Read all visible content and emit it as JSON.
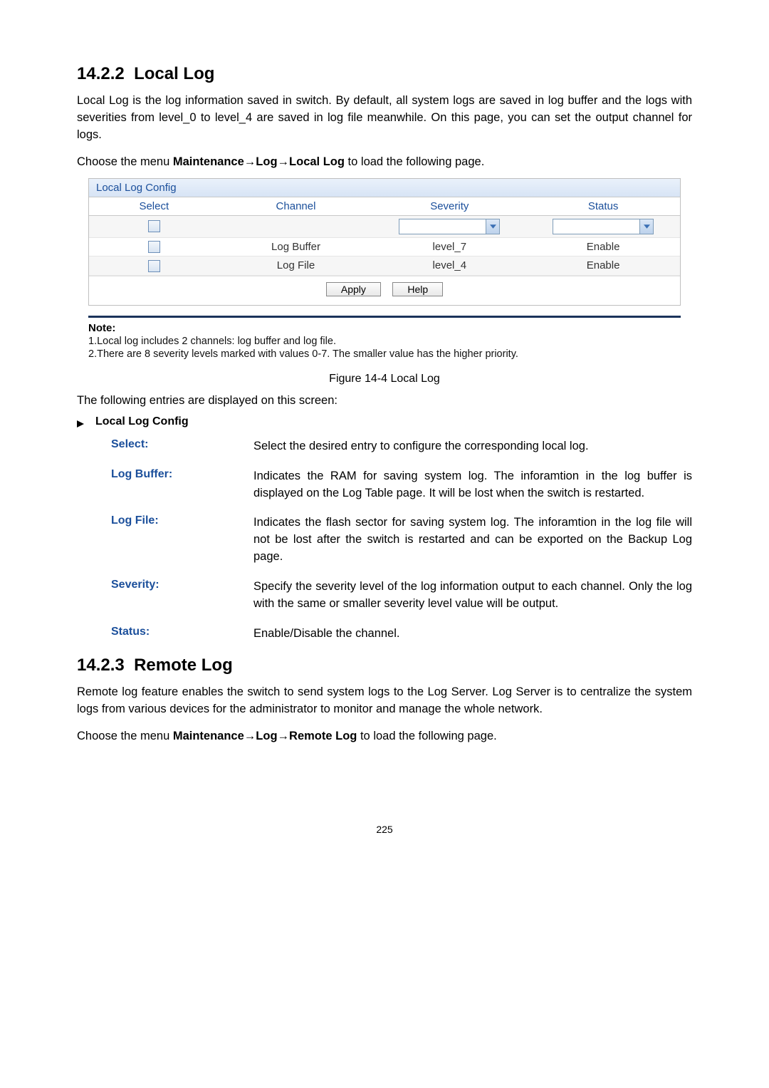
{
  "section1": {
    "number": "14.2.2",
    "title": "Local Log",
    "intro": "Local Log is the log information saved in switch. By default, all system logs are saved in log buffer and the logs with severities from level_0 to level_4 are saved in log file meanwhile. On this page, you can set the output channel for logs.",
    "menu_prefix": "Choose the menu ",
    "menu_path_1": "Maintenance",
    "menu_path_2": "Log",
    "menu_path_3": "Local Log",
    "menu_suffix": " to load the following page."
  },
  "panel": {
    "title": "Local Log Config",
    "headers": {
      "select": "Select",
      "channel": "Channel",
      "severity": "Severity",
      "status": "Status"
    },
    "row_config": {
      "channel": "",
      "severity": "",
      "status": ""
    },
    "row1": {
      "channel": "Log Buffer",
      "severity": "level_7",
      "status": "Enable"
    },
    "row2": {
      "channel": "Log File",
      "severity": "level_4",
      "status": "Enable"
    },
    "buttons": {
      "apply": "Apply",
      "help": "Help"
    }
  },
  "note": {
    "title": "Note:",
    "line1": "1.Local log includes 2 channels: log buffer and log file.",
    "line2": "2.There are 8 severity levels marked with values 0-7. The smaller value has the higher priority."
  },
  "figure_caption": "Figure 14-4 Local Log",
  "entries_intro": "The following entries are displayed on this screen:",
  "config_heading": "Local Log Config",
  "defs": {
    "select": {
      "term": "Select:",
      "desc": "Select the desired entry to configure the corresponding local log."
    },
    "logbuffer": {
      "term": "Log Buffer:",
      "desc": "Indicates the RAM for saving system log. The inforamtion in the log buffer is displayed on the Log Table page. It will be lost when the switch is restarted."
    },
    "logfile": {
      "term": "Log File:",
      "desc": "Indicates the flash sector for saving system log. The inforamtion in the log file will not be lost after the switch is restarted and can be exported on the Backup Log page."
    },
    "severity": {
      "term": "Severity:",
      "desc": "Specify the severity level of the log information output to each channel. Only the log with the same or smaller severity level value will be output."
    },
    "status": {
      "term": "Status:",
      "desc": "Enable/Disable the channel."
    }
  },
  "section2": {
    "number": "14.2.3",
    "title": "Remote Log",
    "intro": "Remote log feature enables the switch to send system logs to the Log Server. Log Server is to centralize the system logs from various devices for the administrator to monitor and manage the whole network.",
    "menu_prefix": "Choose the menu ",
    "menu_path_1": "Maintenance",
    "menu_path_2": "Log",
    "menu_path_3": "Remote Log",
    "menu_suffix": " to load the following page."
  },
  "page_number": "225"
}
